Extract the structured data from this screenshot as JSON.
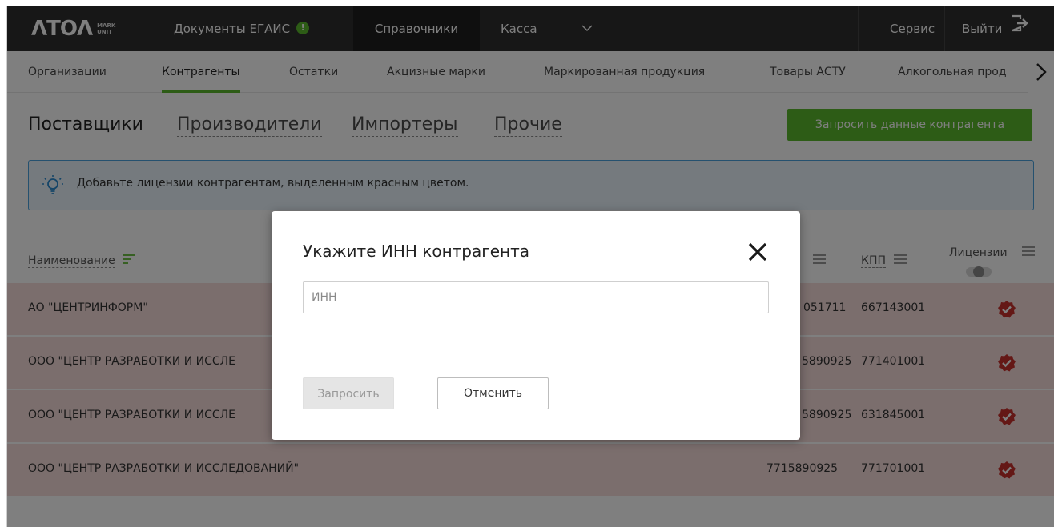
{
  "brand": {
    "logo_main": "ΛTOΛ",
    "logo_sub_1": "MARK",
    "logo_sub_2": "UNIT"
  },
  "topnav": {
    "docs_label": "Документы ЕГАИС",
    "docs_badge": "!",
    "directories_label": "Справочники",
    "cash_label": "Касса",
    "service_label": "Сервис",
    "logout_label": "Выйти"
  },
  "subnav": {
    "items": [
      {
        "label": "Организации"
      },
      {
        "label": "Контрагенты"
      },
      {
        "label": "Остатки"
      },
      {
        "label": "Акцизные марки"
      },
      {
        "label": "Маркированная продукция"
      },
      {
        "label": "Товары АСТУ"
      },
      {
        "label": "Алкогольная прод"
      }
    ]
  },
  "tabs": {
    "suppliers": "Поставщики",
    "manufacturers": "Производители",
    "importers": "Импортеры",
    "other": "Прочие"
  },
  "request_button_label": "Запросить данные контрагента",
  "info_message": "Добавьте лицензии контрагентам, выделенным красным цветом.",
  "table": {
    "headers": {
      "name": "Наименование",
      "kpp": "КПП",
      "licenses": "Лицензии"
    },
    "rows": [
      {
        "name": "АО \"ЦЕНТРИНФОРМ\"",
        "inn": "051711",
        "kpp": "667143001"
      },
      {
        "name": "ООО \"ЦЕНТР РАЗРАБОТКИ И ИССЛЕ",
        "inn": "5890925",
        "kpp": "771401001"
      },
      {
        "name": "ООО \"ЦЕНТР РАЗРАБОТКИ И ИССЛЕ",
        "inn": "5890925",
        "kpp": "631845001"
      },
      {
        "name": "ООО \"ЦЕНТР РАЗРАБОТКИ И ИССЛЕДОВАНИЙ\"",
        "inn": "7715890925",
        "kpp": "771701001"
      }
    ]
  },
  "modal": {
    "title": "Укажите ИНН контрагента",
    "input_placeholder": "ИНН",
    "input_value": "",
    "submit_label": "Запросить",
    "cancel_label": "Отменить"
  },
  "colors": {
    "accent_green": "#5bb82c",
    "topbar": "#2f2f2f",
    "row_highlight": "#f6dcdb",
    "check_red": "#c9302c",
    "info_border": "#4aa3df"
  }
}
